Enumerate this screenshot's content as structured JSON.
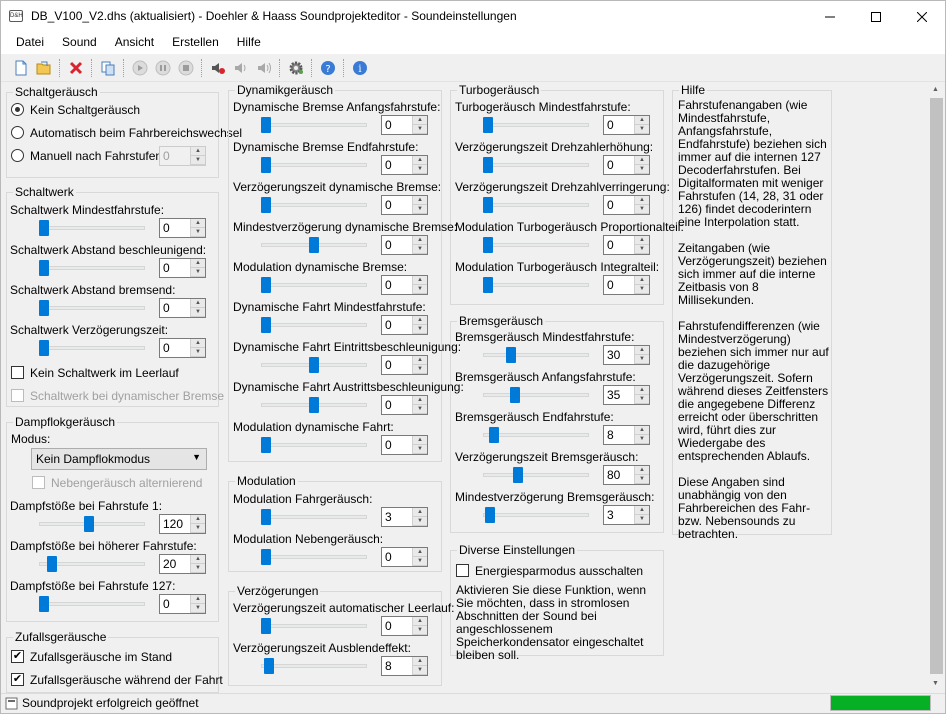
{
  "window": {
    "title": "DB_V100_V2.dhs (aktualisiert) - Doehler & Haass Soundprojekteditor - Soundeinstellungen",
    "icon_label": "D&H"
  },
  "menu": [
    "Datei",
    "Sound",
    "Ansicht",
    "Erstellen",
    "Hilfe"
  ],
  "toolbar_icons": [
    "new-file-icon",
    "open-folder-icon",
    "delete-icon",
    "copy-pages-icon",
    "play-icon",
    "pause-icon",
    "stop-icon",
    "speaker-record-icon",
    "speaker-icon",
    "speaker-volume-icon",
    "settings-gear-icon",
    "help-icon",
    "info-icon"
  ],
  "schaltgeraeusch": {
    "title": "Schaltgeräusch",
    "radio1": "Kein Schaltgeräusch",
    "radio2": "Automatisch beim Fahrbereichswechsel",
    "radio3": "Manuell nach Fahrstufen:",
    "manual_value": "0",
    "selected": 0
  },
  "schaltwerk": {
    "title": "Schaltwerk",
    "rows": [
      {
        "label": "Schaltwerk Mindestfahrstufe:",
        "value": "0",
        "level": 0
      },
      {
        "label": "Schaltwerk Abstand beschleunigend:",
        "value": "0",
        "level": 0
      },
      {
        "label": "Schaltwerk Abstand bremsend:",
        "value": "0",
        "level": 0
      },
      {
        "label": "Schaltwerk Verzögerungszeit:",
        "value": "0",
        "level": 0
      }
    ],
    "chk1": "Kein Schaltwerk im Leerlauf",
    "chk2": "Schaltwerk bei dynamischer Bremse"
  },
  "dampflok": {
    "title": "Dampflokgeräusch",
    "modus_label": "Modus:",
    "modus_value": "Kein Dampflokmodus",
    "neben_label": "Nebengeräusch alternierend",
    "rows": [
      {
        "label": "Dampfstöße bei Fahrstufe 1:",
        "value": "120",
        "level": 0.47
      },
      {
        "label": "Dampfstöße bei höherer Fahrstufe:",
        "value": "20",
        "level": 0.08
      },
      {
        "label": "Dampfstöße bei Fahrstufe 127:",
        "value": "0",
        "level": 0
      }
    ]
  },
  "zufall": {
    "title": "Zufallsgeräusche",
    "chk1": "Zufallsgeräusche im Stand",
    "chk2": "Zufallsgeräusche während der Fahrt"
  },
  "dynamik": {
    "title": "Dynamikgeräusch",
    "rows": [
      {
        "label": "Dynamische Bremse Anfangsfahrstufe:",
        "value": "0",
        "level": 0
      },
      {
        "label": "Dynamische Bremse Endfahrstufe:",
        "value": "0",
        "level": 0
      },
      {
        "label": "Verzögerungszeit dynamische Bremse:",
        "value": "0",
        "level": 0
      },
      {
        "label": "Mindestverzögerung dynamische Bremse:",
        "value": "0",
        "level": 0.5
      },
      {
        "label": "Modulation dynamische Bremse:",
        "value": "0",
        "level": 0
      },
      {
        "label": "Dynamische Fahrt Mindestfahrstufe:",
        "value": "0",
        "level": 0
      },
      {
        "label": "Dynamische Fahrt Eintrittsbeschleunigung:",
        "value": "0",
        "level": 0.5
      },
      {
        "label": "Dynamische Fahrt Austrittsbeschleunigung:",
        "value": "0",
        "level": 0.5
      },
      {
        "label": "Modulation dynamische Fahrt:",
        "value": "0",
        "level": 0
      }
    ]
  },
  "modulation": {
    "title": "Modulation",
    "rows": [
      {
        "label": "Modulation Fahrgeräusch:",
        "value": "3",
        "level": 0
      },
      {
        "label": "Modulation Nebengeräusch:",
        "value": "0",
        "level": 0
      }
    ]
  },
  "verzoegerungen": {
    "title": "Verzögerungen",
    "rows": [
      {
        "label": "Verzögerungszeit automatischer Leerlauf:",
        "value": "0",
        "level": 0
      },
      {
        "label": "Verzögerungszeit Ausblendeffekt:",
        "value": "8",
        "level": 0.03
      }
    ]
  },
  "turbo": {
    "title": "Turbogeräusch",
    "rows": [
      {
        "label": "Turbogeräusch Mindestfahrstufe:",
        "value": "0",
        "level": 0
      },
      {
        "label": "Verzögerungszeit Drehzahlerhöhung:",
        "value": "0",
        "level": 0
      },
      {
        "label": "Verzögerungszeit Drehzahlverringerung:",
        "value": "0",
        "level": 0
      },
      {
        "label": "Modulation Turbogeräusch Proportionalteil:",
        "value": "0",
        "level": 0
      },
      {
        "label": "Modulation Turbogeräusch Integralteil:",
        "value": "0",
        "level": 0
      }
    ]
  },
  "brems": {
    "title": "Bremsgeräusch",
    "rows": [
      {
        "label": "Bremsgeräusch Mindestfahrstufe:",
        "value": "30",
        "level": 0.24
      },
      {
        "label": "Bremsgeräusch Anfangsfahrstufe:",
        "value": "35",
        "level": 0.28
      },
      {
        "label": "Bremsgeräusch Endfahrstufe:",
        "value": "8",
        "level": 0.06
      },
      {
        "label": "Verzögerungszeit Bremsgeräusch:",
        "value": "80",
        "level": 0.31
      },
      {
        "label": "Mindestverzögerung Bremsgeräusch:",
        "value": "3",
        "level": 0.02
      }
    ]
  },
  "diverse": {
    "title": "Diverse Einstellungen",
    "chk": "Energiesparmodus ausschalten",
    "text": "Aktivieren Sie diese Funktion, wenn Sie möchten, dass in stromlosen Abschnitten der Sound bei angeschlossenem Speicherkondensator eingeschaltet bleiben soll."
  },
  "hilfe": {
    "title": "Hilfe",
    "p1": "Fahrstufenangaben (wie Mindestfahrstufe, Anfangsfahrstufe, Endfahrstufe) beziehen sich immer auf die internen 127 Decoderfahrstufen. Bei Digitalformaten mit weniger Fahrstufen (14, 28, 31 oder 126) findet decoderintern eine Interpolation statt.",
    "p2": "Zeitangaben (wie Verzögerungszeit) beziehen sich immer auf die interne Zeitbasis von 8 Millisekunden.",
    "p3": "Fahrstufendifferenzen (wie Mindestverzögerung) beziehen sich immer nur auf die dazugehörige Verzögerungszeit. Sofern während dieses Zeitfensters die angegebene Differenz erreicht oder überschritten wird, führt dies zur Wiedergabe des entsprechenden Ablaufs.",
    "p4": "Diese Angaben sind unabhängig von den Fahrbereichen des Fahr- bzw. Nebensounds zu betrachten."
  },
  "status": {
    "text": "Soundprojekt erfolgreich geöffnet",
    "progress": 1.0,
    "progress_color": "#06b025"
  }
}
